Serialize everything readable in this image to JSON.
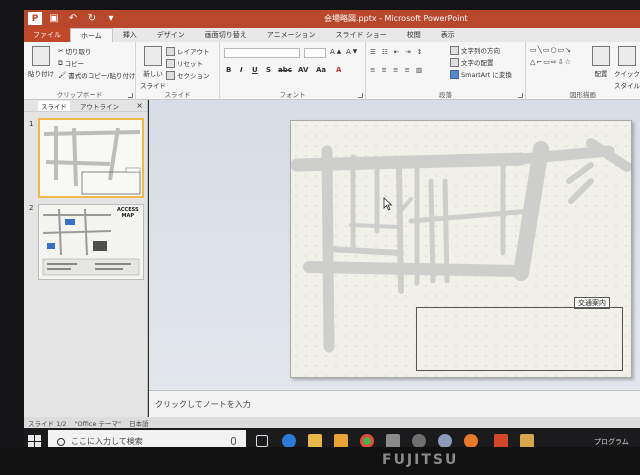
{
  "window": {
    "title": "会場略図.pptx - Microsoft PowerPoint",
    "app_logo": "P",
    "qat_icons": [
      "save-icon",
      "undo-icon",
      "redo-icon"
    ]
  },
  "tabs": [
    {
      "label": "ファイル",
      "kind": "file"
    },
    {
      "label": "ホーム",
      "kind": "active"
    },
    {
      "label": "挿入",
      "kind": ""
    },
    {
      "label": "デザイン",
      "kind": ""
    },
    {
      "label": "画面切り替え",
      "kind": ""
    },
    {
      "label": "アニメーション",
      "kind": ""
    },
    {
      "label": "スライド ショー",
      "kind": ""
    },
    {
      "label": "校閲",
      "kind": ""
    },
    {
      "label": "表示",
      "kind": ""
    }
  ],
  "ribbon": {
    "clipboard": {
      "paste": "貼り付け",
      "cut": "切り取り",
      "copy": "コピー",
      "format_painter": "書式のコピー/貼り付け",
      "label": "クリップボード"
    },
    "slides": {
      "new_slide": "新しい",
      "new_slide_line2": "スライド",
      "layout": "レイアウト",
      "reset": "リセット",
      "section": "セクション",
      "label": "スライド"
    },
    "font": {
      "format_buttons": [
        "B",
        "I",
        "U",
        "S",
        "abc",
        "AV",
        "Aa",
        "A"
      ],
      "label": "フォント"
    },
    "paragraph": {
      "text_direction": "文字列の方向",
      "align_text": "文字の配置",
      "smartart": "SmartArt に変換",
      "label": "段落"
    },
    "drawing": {
      "arrange": "配置",
      "quick_styles": "クイック",
      "quick_styles_line2": "スタイル",
      "label": "図形描画"
    }
  },
  "left_pane": {
    "tabs": [
      "スライド",
      "アウトライン"
    ],
    "close": "×",
    "slide_numbers": [
      "1",
      "2"
    ],
    "thumb2_title_line1": "ACCESS",
    "thumb2_title_line2": "MAP"
  },
  "slide": {
    "box_label": "交通案内"
  },
  "notes": {
    "placeholder": "クリックしてノートを入力"
  },
  "status": {
    "slide_info": "スライド 1/2",
    "theme": "\"Office テーマ\"",
    "language": "日本語"
  },
  "taskbar": {
    "search_placeholder": "ここに入力して検索",
    "apps": [
      "task-view-icon",
      "edge-icon",
      "explorer-icon",
      "store-icon",
      "chrome-icon",
      "app-icon",
      "app-icon",
      "app-icon",
      "firefox-icon",
      "powerpoint-icon",
      "app-icon"
    ],
    "tray_text": "プログラム"
  },
  "bezel": {
    "brand": "FUJITSU"
  },
  "colors": {
    "accent": "#b9472b",
    "map_road": "#cfcfcd",
    "selection": "#f2b84c"
  }
}
